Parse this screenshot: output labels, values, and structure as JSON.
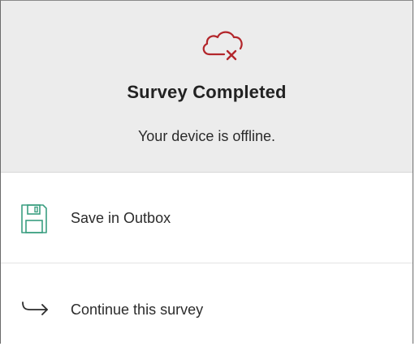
{
  "dialog": {
    "icon": "cloud-offline-icon",
    "title": "Survey Completed",
    "message": "Your device is offline."
  },
  "options": [
    {
      "icon": "save-floppy-icon",
      "label": "Save in Outbox"
    },
    {
      "icon": "continue-arrow-icon",
      "label": "Continue this survey"
    }
  ],
  "colors": {
    "header_bg": "#ececec",
    "error_red": "#b3262b",
    "save_green": "#3a9e80",
    "text": "#2b2b2b"
  }
}
